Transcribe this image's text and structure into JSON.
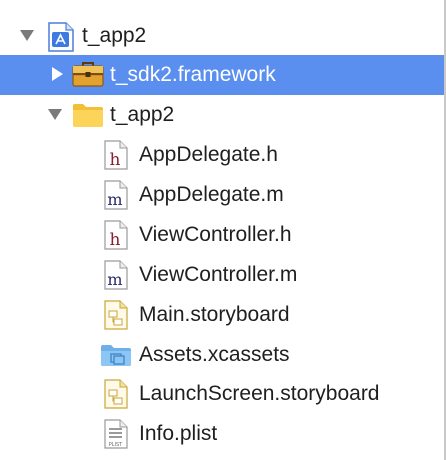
{
  "navigator": {
    "items": [
      {
        "label": "t_app2",
        "icon": "xcode-project-icon",
        "disclosure": "expanded",
        "selected": false
      },
      {
        "label": "t_sdk2.framework",
        "icon": "framework-toolbox-icon",
        "disclosure": "collapsed",
        "selected": true
      },
      {
        "label": "t_app2",
        "icon": "folder-icon",
        "disclosure": "expanded",
        "selected": false
      },
      {
        "label": "AppDelegate.h",
        "icon": "header-file-icon",
        "glyph": "h",
        "selected": false
      },
      {
        "label": "AppDelegate.m",
        "icon": "objc-source-file-icon",
        "glyph": "m",
        "selected": false
      },
      {
        "label": "ViewController.h",
        "icon": "header-file-icon",
        "glyph": "h",
        "selected": false
      },
      {
        "label": "ViewController.m",
        "icon": "objc-source-file-icon",
        "glyph": "m",
        "selected": false
      },
      {
        "label": "Main.storyboard",
        "icon": "storyboard-file-icon",
        "selected": false
      },
      {
        "label": "Assets.xcassets",
        "icon": "asset-catalog-folder-icon",
        "selected": false
      },
      {
        "label": "LaunchScreen.storyboard",
        "icon": "storyboard-file-icon",
        "selected": false
      },
      {
        "label": "Info.plist",
        "icon": "plist-file-icon",
        "glyph": "PLIST",
        "selected": false
      }
    ]
  },
  "colors": {
    "selection": "#5a8ff0",
    "folder": "#f5c842",
    "header_glyph": "#8a1f2a",
    "source_glyph": "#2a2a6a"
  }
}
